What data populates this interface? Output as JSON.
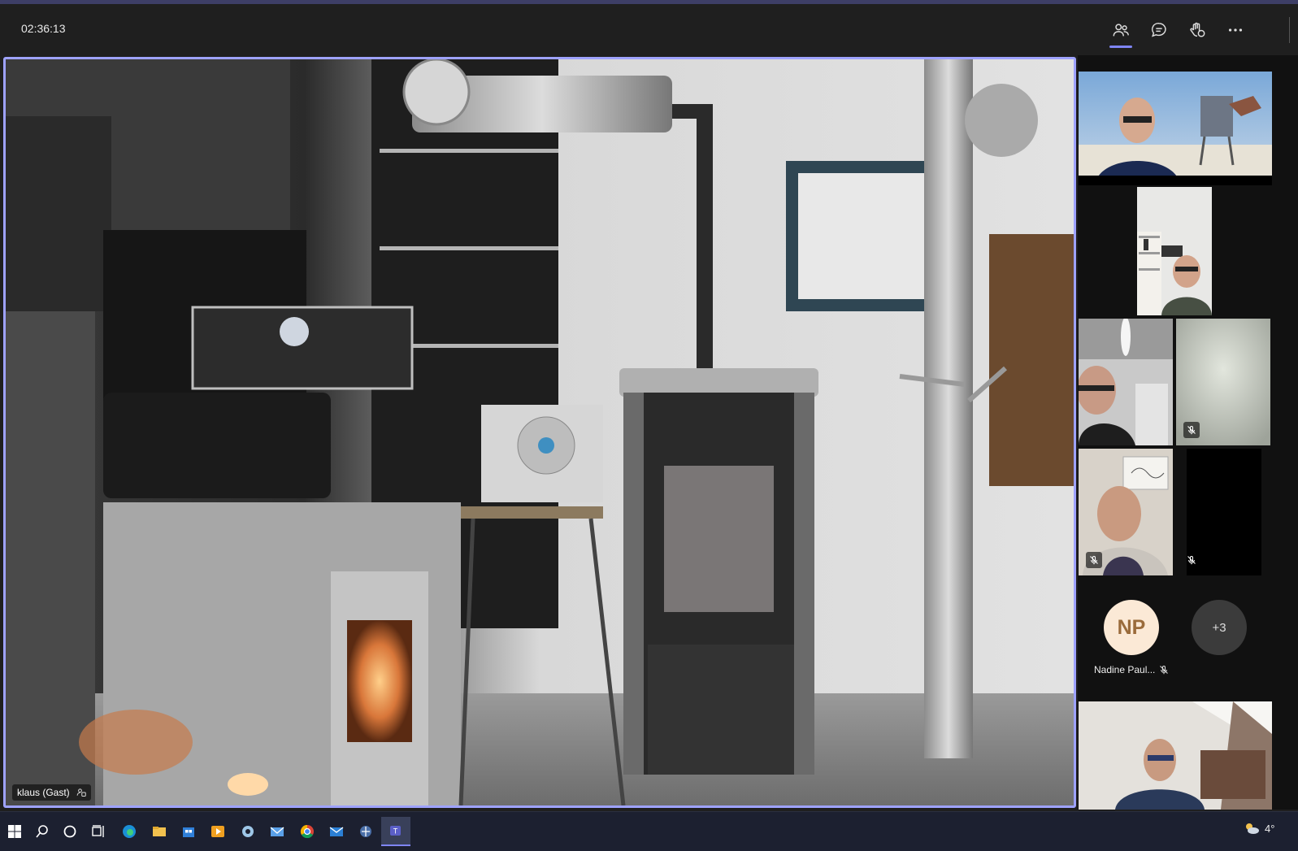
{
  "meeting": {
    "timer": "02:36:13",
    "header_buttons": [
      {
        "name": "participants-button",
        "icon": "people-icon",
        "active": true
      },
      {
        "name": "chat-button",
        "icon": "chat-bubble-icon",
        "active": false
      },
      {
        "name": "reactions-button",
        "icon": "raise-hand-icon",
        "active": false
      },
      {
        "name": "more-actions-button",
        "icon": "more-dots-icon",
        "active": false
      }
    ]
  },
  "main_video": {
    "participant_name": "klaus (Gast)",
    "status_icon": "guest-icon"
  },
  "sidebar": {
    "avatar_participant": {
      "initials": "NP",
      "name": "Nadine Paul...",
      "muted": true
    },
    "overflow_count": "+3",
    "muted_tiles": 3
  },
  "taskbar": {
    "items": [
      "start-icon",
      "search-icon",
      "cortana-icon",
      "task-view-icon",
      "edge-icon",
      "file-explorer-icon",
      "store-icon",
      "media-player-icon",
      "app-icon",
      "mail-app-icon",
      "chrome-icon",
      "mail-icon",
      "network-app-icon",
      "teams-icon"
    ],
    "weather_temp": "4°"
  },
  "colors": {
    "accent": "#9ea2ff",
    "background": "#1f1f1f",
    "avatar_bg": "#fbe9d6",
    "avatar_text": "#9a6b3b"
  }
}
